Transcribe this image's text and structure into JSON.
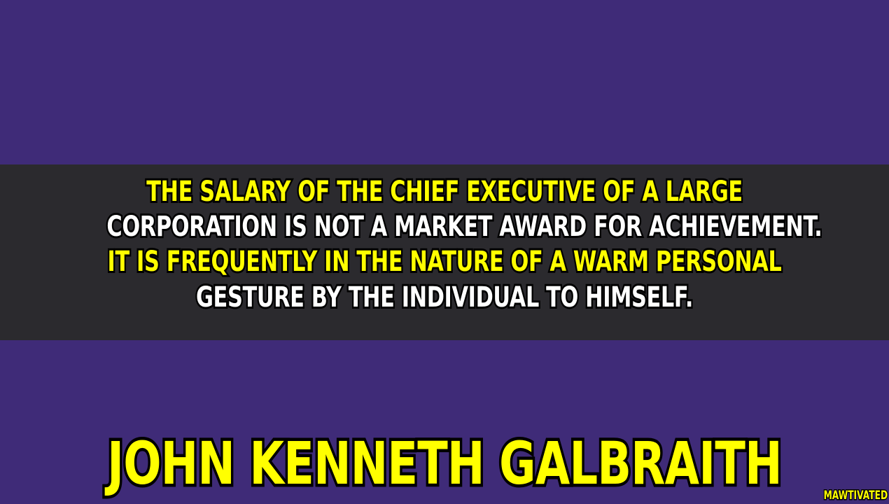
{
  "colors": {
    "background": "#3f2b78",
    "band": "#2b2a2e",
    "highlight": "#ffff00",
    "text": "#ffffff",
    "outline": "#000000"
  },
  "quote": {
    "lines": [
      {
        "text": "THE SALARY OF THE CHIEF EXECUTIVE OF A LARGE",
        "color": "#ffff00"
      },
      {
        "text": "CORPORATION IS NOT A MARKET AWARD FOR ACHIEVEMENT.",
        "color": "#ffffff"
      },
      {
        "text": "IT IS FREQUENTLY IN THE NATURE OF A WARM PERSONAL",
        "color": "#ffff00"
      },
      {
        "text": "GESTURE BY THE INDIVIDUAL TO HIMSELF.",
        "color": "#ffffff"
      }
    ]
  },
  "author": {
    "name": "JOHN KENNETH GALBRAITH",
    "color": "#ffff00"
  },
  "watermark": {
    "text": "MAWTIVATED",
    "color": "#ffff00"
  }
}
